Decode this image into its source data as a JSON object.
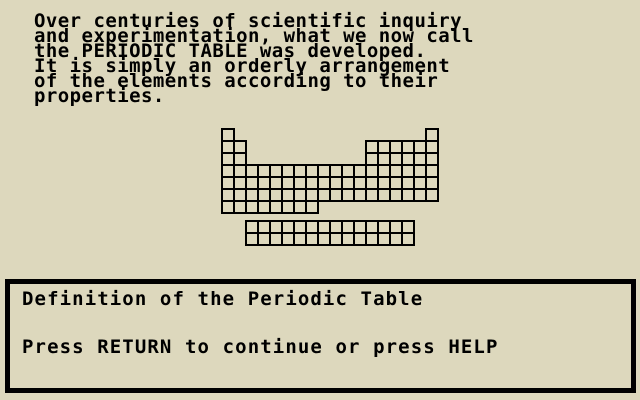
{
  "intro": {
    "lines": [
      "Over centuries of scientific inquiry",
      "and experimentation, what we now call",
      "the PERIODIC TABLE was developed.",
      "It is simply an orderly arrangement",
      "of the elements according to their",
      "properties."
    ]
  },
  "prompt": {
    "title": "Definition of the Periodic Table",
    "instruction_prefix": "Press ",
    "return_key": "RETURN",
    "instruction_middle": " to continue or press ",
    "help_key": "HELP"
  },
  "periodic_table_icon": {
    "name": "periodic-table-icon",
    "main_rows": 7,
    "main_columns": 18,
    "f_block_rows": 2,
    "f_block_columns": 14
  },
  "colors": {
    "background": "#ddd8bd",
    "foreground": "#000000"
  }
}
